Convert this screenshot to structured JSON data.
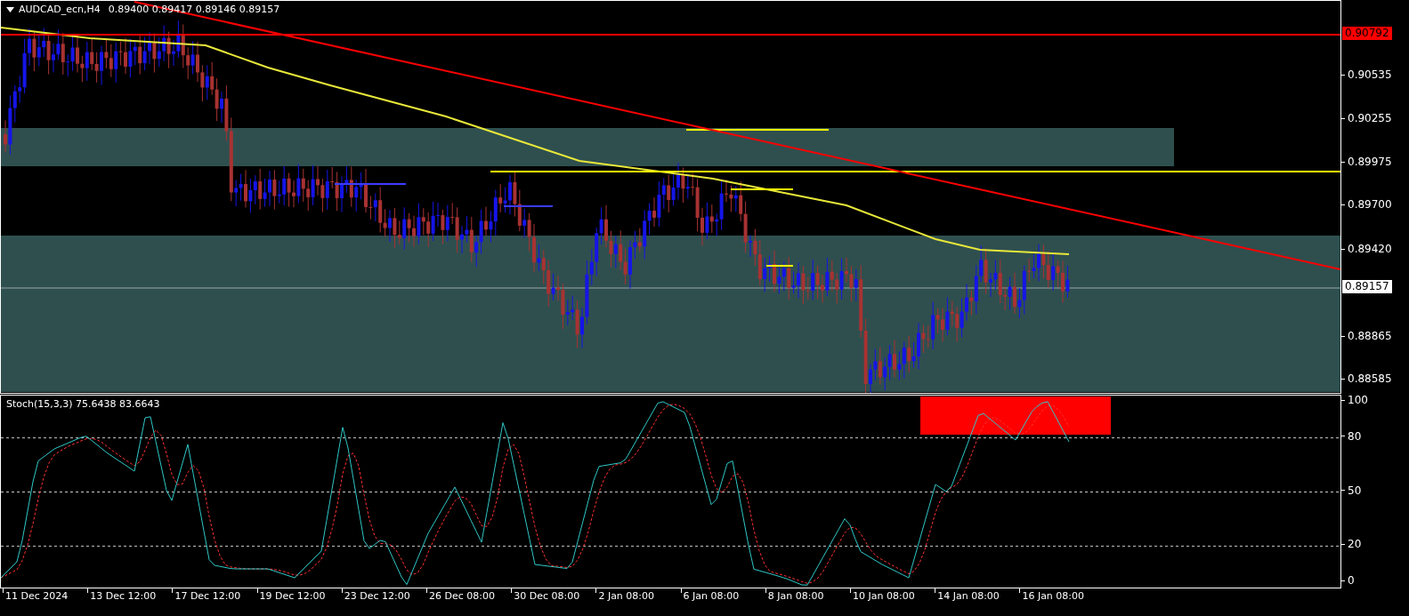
{
  "chart": {
    "symbol": "AUDCAD_ecn,H4",
    "ohlc": "0.89400 0.89417 0.89146 0.89157",
    "price_labels": [
      "0.90535",
      "0.90255",
      "0.89975",
      "0.89700",
      "0.89420",
      "0.88865",
      "0.88585"
    ],
    "marked_prices": [
      {
        "kind": "line",
        "text": "0.90792",
        "color": "#ff0000"
      },
      {
        "kind": "bid",
        "text": "0.89157",
        "color": "#ffffff"
      }
    ]
  },
  "indicator": {
    "title": "Stoch(15,3,3) 75.6438 83.6643",
    "levels": [
      "100",
      "80",
      "50",
      "20",
      "0"
    ]
  },
  "time_axis": [
    "11 Dec 2024",
    "13 Dec 12:00",
    "17 Dec 12:00",
    "19 Dec 12:00",
    "23 Dec 12:00",
    "26 Dec 08:00",
    "30 Dec 08:00",
    "2 Jan 08:00",
    "6 Jan 08:00",
    "8 Jan 08:00",
    "10 Jan 08:00",
    "14 Jan 08:00",
    "16 Jan 08:00"
  ]
}
